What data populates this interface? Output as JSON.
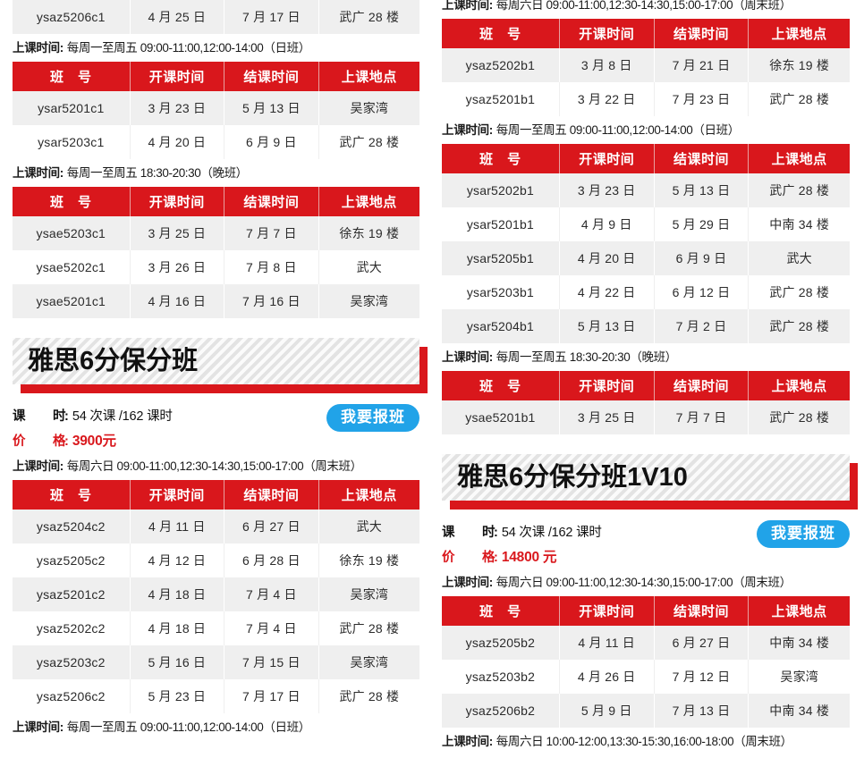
{
  "left": {
    "top_partial_row": {
      "class_no": "ysaz5206c1",
      "start": "4 月 25 日",
      "end": "7 月 17 日",
      "location": "武广 28 楼"
    },
    "sections": [
      {
        "schedule_label": "上课时间:",
        "schedule_value": "每周一至周五 09:00-11:00,12:00-14:00（日班）",
        "headers": [
          "班　号",
          "开课时间",
          "结课时间",
          "上课地点"
        ],
        "rows": [
          [
            "ysar5201c1",
            "3 月 23 日",
            "5 月 13 日",
            "吴家湾"
          ],
          [
            "ysar5203c1",
            "4 月 20 日",
            "6 月 9 日",
            "武广 28 楼"
          ]
        ]
      },
      {
        "schedule_label": "上课时间:",
        "schedule_value": "每周一至周五 18:30-20:30（晚班）",
        "headers": [
          "班　号",
          "开课时间",
          "结课时间",
          "上课地点"
        ],
        "rows": [
          [
            "ysae5203c1",
            "3 月 25 日",
            "7 月 7 日",
            "徐东 19 楼"
          ],
          [
            "ysae5202c1",
            "3 月 26 日",
            "7 月 8 日",
            "武大"
          ],
          [
            "ysae5201c1",
            "4 月 16 日",
            "7 月 16 日",
            "吴家湾"
          ]
        ]
      }
    ],
    "course": {
      "title": "雅思6分保分班",
      "hours_label": "课　时",
      "hours_value": "54 次课 /162 课时",
      "price_label": "价　格",
      "price_value": "3900元",
      "enroll_label": "我要报班",
      "schedule_label": "上课时间:",
      "schedule_value": "每周六日 09:00-11:00,12:30-14:30,15:00-17:00（周末班）",
      "headers": [
        "班　号",
        "开课时间",
        "结课时间",
        "上课地点"
      ],
      "rows": [
        [
          "ysaz5204c2",
          "4 月 11 日",
          "6 月 27 日",
          "武大"
        ],
        [
          "ysaz5205c2",
          "4 月 12 日",
          "6 月 28 日",
          "徐东 19 楼"
        ],
        [
          "ysaz5201c2",
          "4 月 18 日",
          "7 月 4 日",
          "吴家湾"
        ],
        [
          "ysaz5202c2",
          "4 月 18 日",
          "7 月 4 日",
          "武广 28 楼"
        ],
        [
          "ysaz5203c2",
          "5 月 16 日",
          "7 月 15 日",
          "吴家湾"
        ],
        [
          "ysaz5206c2",
          "5 月 23 日",
          "7 月 17 日",
          "武广 28 楼"
        ]
      ],
      "bottom_schedule_label": "上课时间:",
      "bottom_schedule_value": "每周一至周五 09:00-11:00,12:00-14:00（日班）"
    }
  },
  "right": {
    "top_schedule_label": "上课时间:",
    "top_schedule_value": "每周六日 09:00-11:00,12:30-14:30,15:00-17:00（周末班）",
    "sections": [
      {
        "headers": [
          "班　号",
          "开课时间",
          "结课时间",
          "上课地点"
        ],
        "rows": [
          [
            "ysaz5202b1",
            "3 月 8 日",
            "7 月 21 日",
            "徐东 19 楼"
          ],
          [
            "ysaz5201b1",
            "3 月 22 日",
            "7 月 23 日",
            "武广 28 楼"
          ]
        ]
      },
      {
        "schedule_label": "上课时间:",
        "schedule_value": "每周一至周五 09:00-11:00,12:00-14:00（日班）",
        "headers": [
          "班　号",
          "开课时间",
          "结课时间",
          "上课地点"
        ],
        "rows": [
          [
            "ysar5202b1",
            "3 月 23 日",
            "5 月 13 日",
            "武广 28 楼"
          ],
          [
            "ysar5201b1",
            "4 月 9 日",
            "5 月 29 日",
            "中南 34 楼"
          ],
          [
            "ysar5205b1",
            "4 月 20 日",
            "6 月 9 日",
            "武大"
          ],
          [
            "ysar5203b1",
            "4 月 22 日",
            "6 月 12 日",
            "武广 28 楼"
          ],
          [
            "ysar5204b1",
            "5 月 13 日",
            "7 月 2 日",
            "武广 28 楼"
          ]
        ]
      },
      {
        "schedule_label": "上课时间:",
        "schedule_value": "每周一至周五 18:30-20:30（晚班）",
        "headers": [
          "班　号",
          "开课时间",
          "结课时间",
          "上课地点"
        ],
        "rows": [
          [
            "ysae5201b1",
            "3 月 25 日",
            "7 月 7 日",
            "武广 28 楼"
          ]
        ]
      }
    ],
    "course": {
      "title": "雅思6分保分班1V10",
      "hours_label": "课　时",
      "hours_value": "54 次课 /162 课时",
      "price_label": "价　格",
      "price_value": "14800 元",
      "enroll_label": "我要报班",
      "schedule_label": "上课时间:",
      "schedule_value": "每周六日 09:00-11:00,12:30-14:30,15:00-17:00（周末班）",
      "headers": [
        "班　号",
        "开课时间",
        "结课时间",
        "上课地点"
      ],
      "rows": [
        [
          "ysaz5205b2",
          "4 月 11 日",
          "6 月 27 日",
          "中南 34 楼"
        ],
        [
          "ysaz5203b2",
          "4 月 26 日",
          "7 月 12 日",
          "吴家湾"
        ],
        [
          "ysaz5206b2",
          "5 月 9 日",
          "7 月 13 日",
          "中南 34 楼"
        ]
      ],
      "bottom_schedule_label": "上课时间:",
      "bottom_schedule_value": "每周六日 10:00-12:00,13:30-15:30,16:00-18:00（周末班）"
    }
  },
  "colors": {
    "header_red": "#d9171c",
    "accent_blue": "#21a3e8",
    "row_stripe": "#efefef"
  }
}
